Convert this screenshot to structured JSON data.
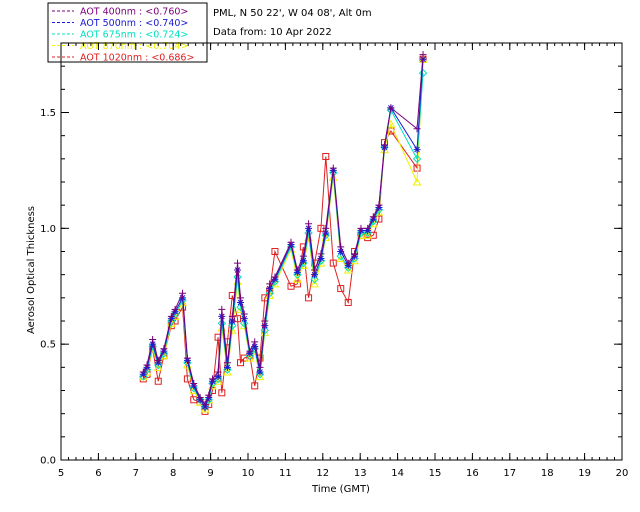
{
  "header": {
    "site": "PML, N 50 22', W 04 08', Alt 0m",
    "date": "Data from: 10 Apr 2022"
  },
  "legend": [
    {
      "label": "AOT  400nm : <0.760>",
      "color": "#7a007a"
    },
    {
      "label": "AOT  500nm : <0.740>",
      "color": "#1a1ad6"
    },
    {
      "label": "AOT  675nm : <0.724>",
      "color": "#00e0c0"
    },
    {
      "label": "AOT  870nm : <0.704>",
      "color": "#f0f000"
    },
    {
      "label": "AOT 1020nm : <0.686>",
      "color": "#e02020"
    }
  ],
  "chart_data": {
    "type": "line",
    "xlabel": "Time (GMT)",
    "ylabel": "Aerosol Optical Thickness",
    "xlim": [
      5,
      20
    ],
    "ylim": [
      0,
      1.8
    ],
    "xticks": [
      "5",
      "6",
      "7",
      "8",
      "9",
      "10",
      "11",
      "12",
      "13",
      "14",
      "15",
      "16",
      "17",
      "18",
      "19",
      "20"
    ],
    "yticks": [
      "0.0",
      "0.5",
      "1.0",
      "1.5"
    ],
    "x": [
      7.2,
      7.3,
      7.45,
      7.6,
      7.75,
      7.95,
      8.05,
      8.25,
      8.38,
      8.55,
      8.72,
      8.85,
      8.95,
      9.05,
      9.2,
      9.3,
      9.45,
      9.58,
      9.72,
      9.8,
      9.9,
      10.05,
      10.18,
      10.32,
      10.45,
      10.58,
      10.72,
      11.15,
      11.32,
      11.48,
      11.62,
      11.78,
      11.95,
      12.08,
      12.28,
      12.48,
      12.68,
      12.85,
      13.02,
      13.2,
      13.35,
      13.5,
      13.65,
      13.82,
      14.52,
      14.68,
      15.02
    ],
    "series": [
      {
        "name": "AOT  400nm : <0.760>",
        "marker": "plus",
        "color": "#7a007a",
        "values": [
          0.38,
          0.41,
          0.52,
          0.43,
          0.48,
          0.62,
          0.65,
          0.72,
          0.44,
          0.33,
          0.27,
          0.24,
          0.28,
          0.35,
          0.38,
          0.65,
          0.42,
          0.62,
          0.85,
          0.7,
          0.63,
          0.47,
          0.51,
          0.4,
          0.6,
          0.76,
          0.79,
          0.94,
          0.82,
          0.88,
          1.02,
          0.82,
          0.89,
          1.0,
          1.26,
          0.92,
          0.85,
          0.89,
          1.0,
          1.0,
          1.05,
          1.1,
          1.36,
          1.52,
          1.43,
          1.75
        ]
      },
      {
        "name": "AOT  500nm : <0.740>",
        "marker": "asterisk",
        "color": "#1a1ad6",
        "values": [
          0.37,
          0.4,
          0.5,
          0.42,
          0.47,
          0.61,
          0.64,
          0.7,
          0.43,
          0.32,
          0.26,
          0.23,
          0.27,
          0.34,
          0.36,
          0.62,
          0.4,
          0.6,
          0.82,
          0.68,
          0.61,
          0.46,
          0.49,
          0.38,
          0.58,
          0.74,
          0.78,
          0.93,
          0.81,
          0.86,
          1.0,
          0.8,
          0.87,
          0.98,
          1.25,
          0.9,
          0.84,
          0.88,
          0.99,
          0.99,
          1.04,
          1.09,
          1.35,
          1.52,
          1.34,
          1.73
        ]
      },
      {
        "name": "AOT  675nm : <0.724>",
        "marker": "diamond",
        "color": "#00e0c0",
        "values": [
          0.36,
          0.39,
          0.49,
          0.41,
          0.46,
          0.6,
          0.63,
          0.69,
          0.42,
          0.31,
          0.26,
          0.23,
          0.26,
          0.33,
          0.35,
          0.59,
          0.39,
          0.58,
          0.79,
          0.66,
          0.59,
          0.45,
          0.48,
          0.37,
          0.56,
          0.72,
          0.77,
          0.92,
          0.8,
          0.85,
          0.98,
          0.78,
          0.86,
          0.97,
          1.24,
          0.88,
          0.83,
          0.87,
          0.98,
          0.98,
          1.03,
          1.08,
          1.35,
          1.51,
          1.3,
          1.67
        ]
      },
      {
        "name": "AOT  870nm : <0.704>",
        "marker": "triangle",
        "color": "#f0f000",
        "values": [
          0.36,
          0.38,
          0.48,
          0.4,
          0.45,
          0.59,
          0.62,
          0.68,
          0.41,
          0.3,
          0.25,
          0.22,
          0.26,
          0.32,
          0.34,
          0.57,
          0.38,
          0.56,
          0.77,
          0.65,
          0.58,
          0.44,
          0.47,
          0.36,
          0.55,
          0.71,
          0.76,
          0.91,
          0.78,
          0.84,
          0.96,
          0.76,
          0.85,
          0.96,
          1.22,
          0.87,
          0.82,
          0.86,
          0.97,
          0.97,
          1.02,
          1.07,
          1.34,
          1.45,
          1.2,
          1.73
        ]
      },
      {
        "name": "AOT 1020nm : <0.686>",
        "marker": "square",
        "color": "#e02020",
        "values": [
          0.35,
          0.37,
          0.48,
          0.34,
          0.45,
          0.58,
          0.6,
          0.66,
          0.35,
          0.26,
          0.25,
          0.21,
          0.24,
          0.3,
          0.53,
          0.29,
          0.51,
          0.71,
          0.61,
          0.42,
          0.44,
          0.45,
          0.32,
          0.44,
          0.7,
          0.73,
          0.9,
          0.75,
          0.76,
          0.92,
          0.7,
          0.85,
          1.0,
          1.31,
          0.85,
          0.74,
          0.68,
          0.9,
          0.97,
          0.96,
          0.97,
          1.04,
          1.37,
          1.42,
          1.26,
          1.73
        ]
      }
    ]
  }
}
